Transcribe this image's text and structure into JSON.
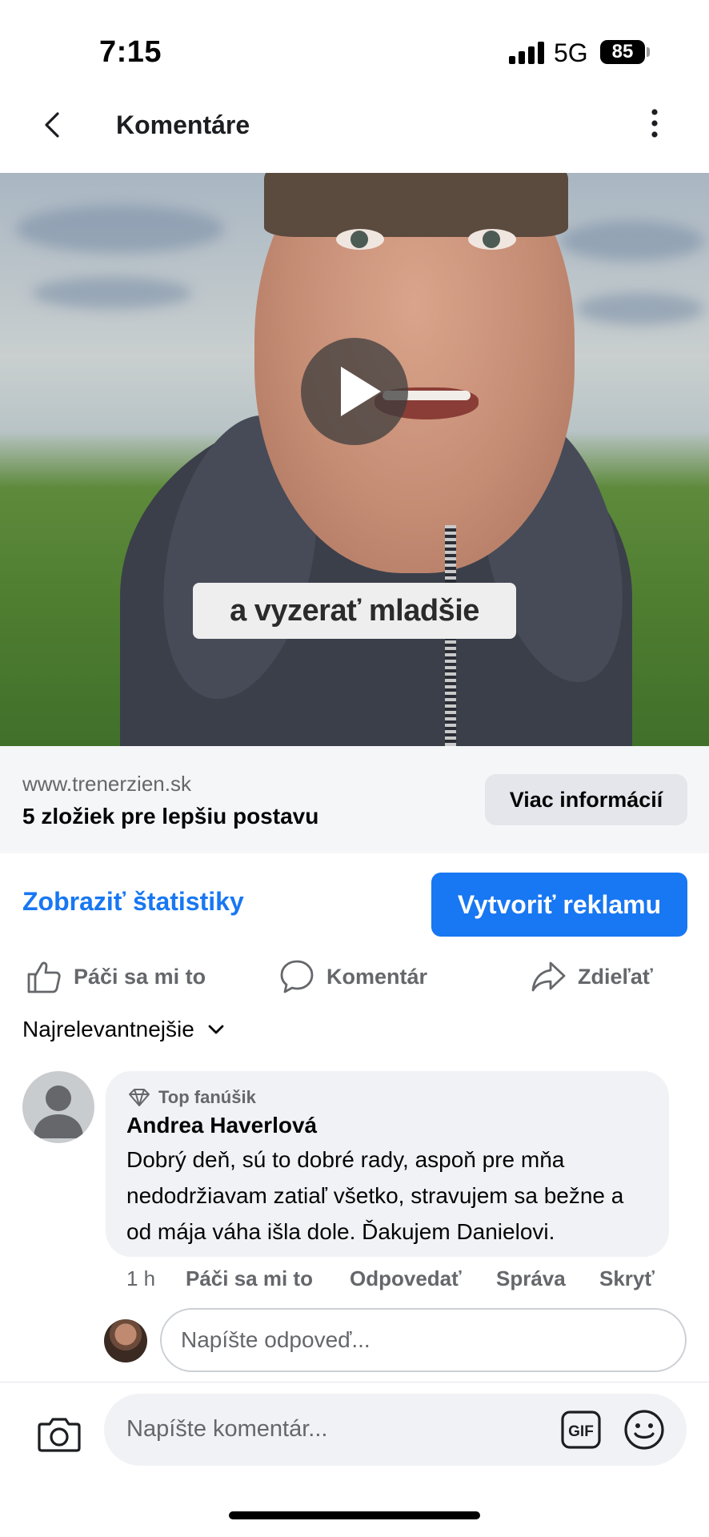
{
  "status_bar": {
    "time": "7:15",
    "network": "5G",
    "battery": "85"
  },
  "header": {
    "title": "Komentáre"
  },
  "video": {
    "caption": "a vyzerať mladšie"
  },
  "link_preview": {
    "domain": "www.trenerzien.sk",
    "title": "5 zložiek pre lepšiu postavu",
    "button_label": "Viac informácií"
  },
  "stats": {
    "link_label": "Zobraziť štatistiky",
    "create_ad_label": "Vytvoriť reklamu"
  },
  "actions": {
    "like": "Páči sa mi to",
    "comment": "Komentár",
    "share": "Zdieľať"
  },
  "sort": {
    "label": "Najrelevantnejšie"
  },
  "comment": {
    "badge": "Top fanúšik",
    "author": "Andrea Haverlová",
    "text": "Dobrý deň, sú to dobré rady, aspoň pre mňa nedodržiavam zatiaľ všetko, stravujem sa bežne a od mája váha išla dole. Ďakujem Danielovi.",
    "time": "1 h",
    "like": "Páči sa mi to",
    "reply": "Odpovedať",
    "message": "Správa",
    "hide": "Skryť"
  },
  "reply_box": {
    "placeholder": "Napíšte odpoveď..."
  },
  "composer": {
    "placeholder": "Napíšte komentár...",
    "gif_label": "GIF"
  },
  "colors": {
    "accent": "#1877f2",
    "secondary_text": "#65676b",
    "bubble_bg": "#f0f2f5"
  }
}
